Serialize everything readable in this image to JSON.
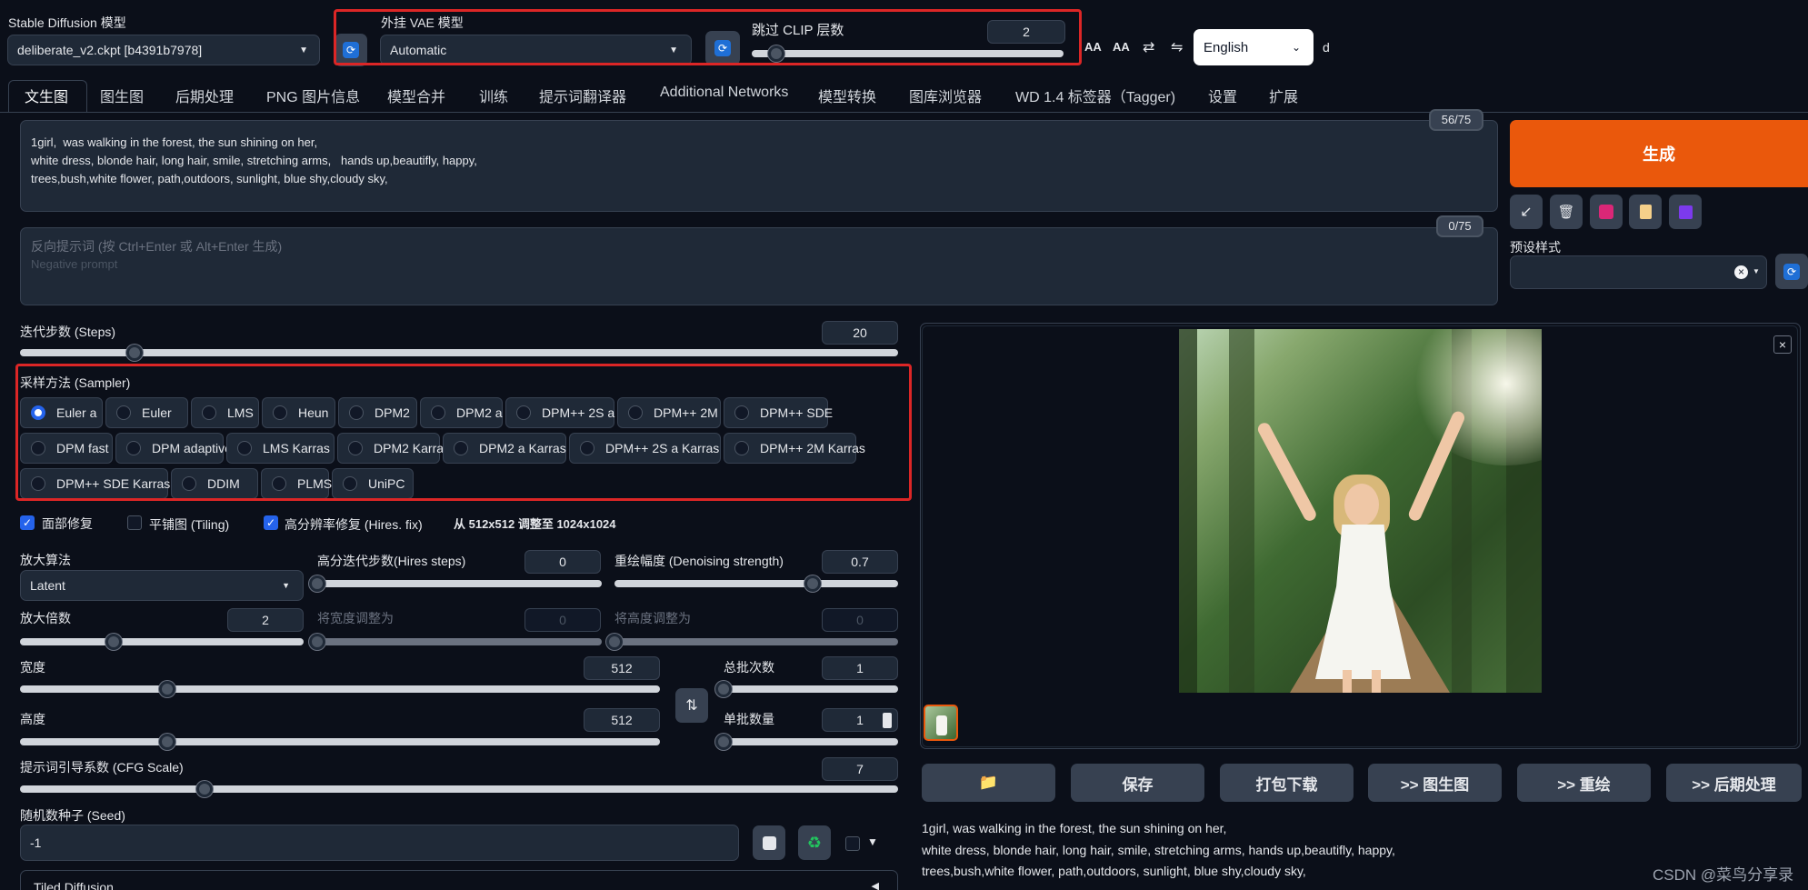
{
  "top": {
    "sd_model_label": "Stable Diffusion 模型",
    "sd_model_value": "deliberate_v2.ckpt [b4391b7978]",
    "vae_label": "外挂 VAE 模型",
    "vae_value": "Automatic",
    "clip_label": "跳过 CLIP 层数",
    "clip_value": "2",
    "clip_fraction": 0.08,
    "toolbar_icons": [
      "AA",
      "AA",
      "⇄",
      "⇋"
    ],
    "language": "English",
    "extra": "d"
  },
  "tabs": [
    "文生图",
    "图生图",
    "后期处理",
    "PNG 图片信息",
    "模型合并",
    "训练",
    "提示词翻译器",
    "Additional Networks",
    "模型转换",
    "图库浏览器",
    "WD 1.4 标签器（Tagger)",
    "设置",
    "扩展"
  ],
  "prompt": {
    "text": "1girl,  was walking in the forest, the sun shining on her,\nwhite dress, blonde hair, long hair, smile, stretching arms,   hands up,beautifly, happy,\ntrees,bush,white flower, path,outdoors, sunlight, blue shy,cloudy sky,",
    "token_count": "56/75",
    "neg_placeholder_1": "反向提示词 (按 Ctrl+Enter 或 Alt+Enter 生成)",
    "neg_placeholder_2": "Negative prompt",
    "neg_token_count": "0/75"
  },
  "generate_label": "生成",
  "styles_label": "预设样式",
  "steps": {
    "label": "迭代步数 (Steps)",
    "value": "20",
    "fraction": 0.13
  },
  "sampler": {
    "label": "采样方法 (Sampler)",
    "selected": "Euler a",
    "rows": [
      [
        "Euler a",
        "Euler",
        "LMS",
        "Heun",
        "DPM2",
        "DPM2 a",
        "DPM++ 2S a",
        "DPM++ 2M",
        "DPM++ SDE"
      ],
      [
        "DPM fast",
        "DPM adaptive",
        "LMS Karras",
        "DPM2 Karras",
        "DPM2 a Karras",
        "DPM++ 2S a Karras",
        "DPM++ 2M Karras"
      ],
      [
        "DPM++ SDE Karras",
        "DDIM",
        "PLMS",
        "UniPC"
      ]
    ]
  },
  "checks": {
    "face_restore": "面部修复",
    "face_restore_checked": true,
    "tiling": "平铺图 (Tiling)",
    "tiling_checked": false,
    "hires": "高分辨率修复 (Hires. fix)",
    "hires_checked": true,
    "hires_info": "从 512x512 调整至 1024x1024"
  },
  "hires": {
    "upscaler_label": "放大算法",
    "upscaler_value": "Latent",
    "hires_steps_label": "高分迭代步数(Hires steps)",
    "hires_steps_value": "0",
    "hires_steps_fraction": 0.0,
    "denoise_label": "重绘幅度 (Denoising strength)",
    "denoise_value": "0.7",
    "denoise_fraction": 0.7,
    "scale_label": "放大倍数",
    "scale_value": "2",
    "scale_fraction": 0.33,
    "resize_w_label": "将宽度调整为",
    "resize_w_value": "0",
    "resize_h_label": "将高度调整为",
    "resize_h_value": "0"
  },
  "size": {
    "width_label": "宽度",
    "width_value": "512",
    "width_fraction": 0.23,
    "height_label": "高度",
    "height_value": "512",
    "height_fraction": 0.23,
    "swap_icon": "⇅",
    "batch_count_label": "总批次数",
    "batch_count_value": "1",
    "batch_size_label": "单批数量",
    "batch_size_value": "1"
  },
  "cfg": {
    "label": "提示词引导系数 (CFG Scale)",
    "value": "7",
    "fraction": 0.21
  },
  "seed": {
    "label": "随机数种子 (Seed)",
    "value": "-1",
    "expand_glyph": "▼"
  },
  "tiled_diffusion": {
    "label": "Tiled Diffusion",
    "arrow": "◀"
  },
  "output": {
    "actions": [
      "📁",
      "保存",
      "打包下载",
      ">> 图生图",
      ">> 重绘",
      ">> 后期处理"
    ],
    "info": "1girl, was walking in the forest, the sun shining on her,\nwhite dress, blonde hair, long hair, smile, stretching arms, hands up,beautifly, happy,\ntrees,bush,white flower, path,outdoors, sunlight, blue shy,cloudy sky,",
    "close_glyph": "×"
  },
  "watermark": "CSDN @菜鸟分享录"
}
